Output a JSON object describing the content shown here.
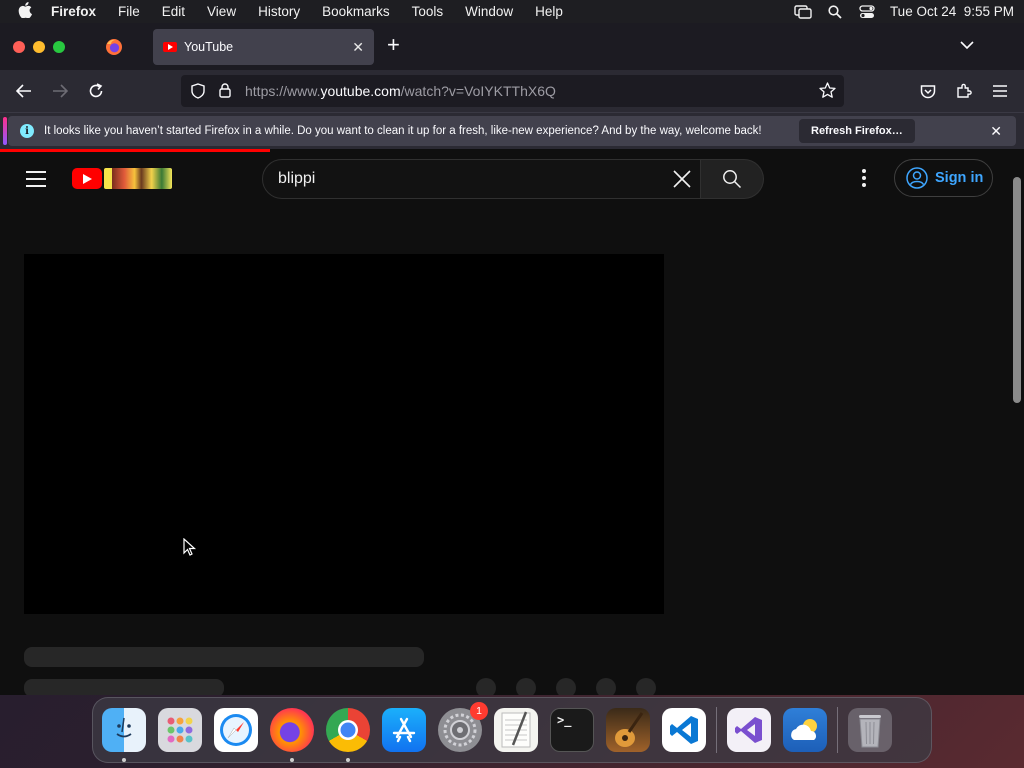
{
  "menubar": {
    "apple": "",
    "items": [
      "Firefox",
      "File",
      "Edit",
      "View",
      "History",
      "Bookmarks",
      "Tools",
      "Window",
      "Help"
    ],
    "clock": "Tue Oct 24  9:55 PM"
  },
  "browser": {
    "tab_title": "YouTube",
    "tab_close": "✕",
    "new_tab": "+",
    "url_prefix": "https://www.",
    "url_host": "youtube.com",
    "url_path": "/watch?v=VoIYKTThX6Q",
    "notification": {
      "text": "It looks like you haven’t started Firefox in a while. Do you want to clean it up for a fresh, like-new experience? And by the way, welcome back!",
      "button": "Refresh Firefox…",
      "close": "✕"
    }
  },
  "youtube": {
    "search_value": "blippi",
    "sign_in": "Sign in"
  },
  "dock": {
    "apps": [
      "finder",
      "launchpad",
      "safari",
      "firefox",
      "chrome",
      "app-store",
      "system-settings",
      "textedit",
      "terminal",
      "garageband",
      "vscode",
      "visual-studio",
      "weather",
      "trash"
    ],
    "settings_badge": "1",
    "terminal_glyph": ">_"
  },
  "colors": {
    "accent_blue": "#3ea6ff",
    "yt_red": "#ff0000",
    "page_bg": "#0f0f0f"
  }
}
